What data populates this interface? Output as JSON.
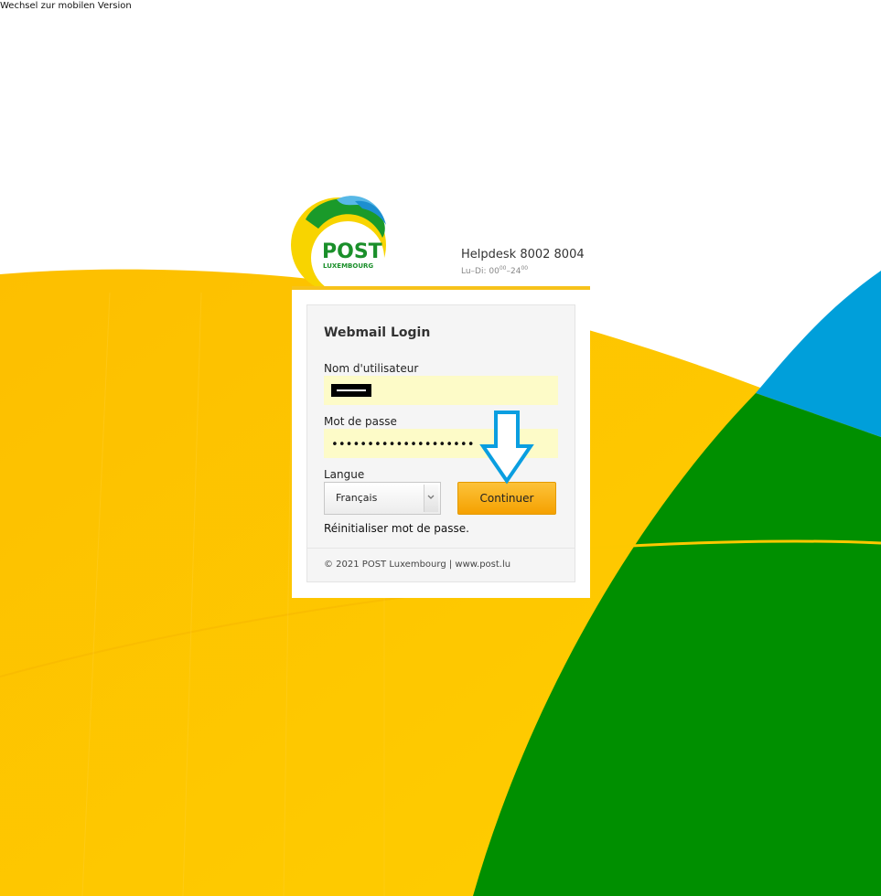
{
  "top": {
    "mobile_link": "Wechsel zur mobilen Version"
  },
  "brand": {
    "logo_word": "POST",
    "logo_sub": "LUXEMBOURG",
    "helpdesk": "Helpdesk 8002 8004",
    "hours_prefix": "Lu–Di: 00",
    "hours_sup1": "00",
    "hours_mid": "–24",
    "hours_sup2": "00"
  },
  "login": {
    "title": "Webmail Login",
    "username_label": "Nom d'utilisateur",
    "password_label": "Mot de passe",
    "password_value": "••••••••••••••••••••",
    "language_label": "Langue",
    "language_selected": "Français",
    "continue_label": "Continuer",
    "reset_link": "Réinitialiser mot de passe.",
    "footer": "© 2021 POST Luxembourg | www.post.lu"
  },
  "colors": {
    "yellow": "#fdc800",
    "green": "#008c00",
    "blue": "#009fda",
    "button": "#f7ad10"
  }
}
